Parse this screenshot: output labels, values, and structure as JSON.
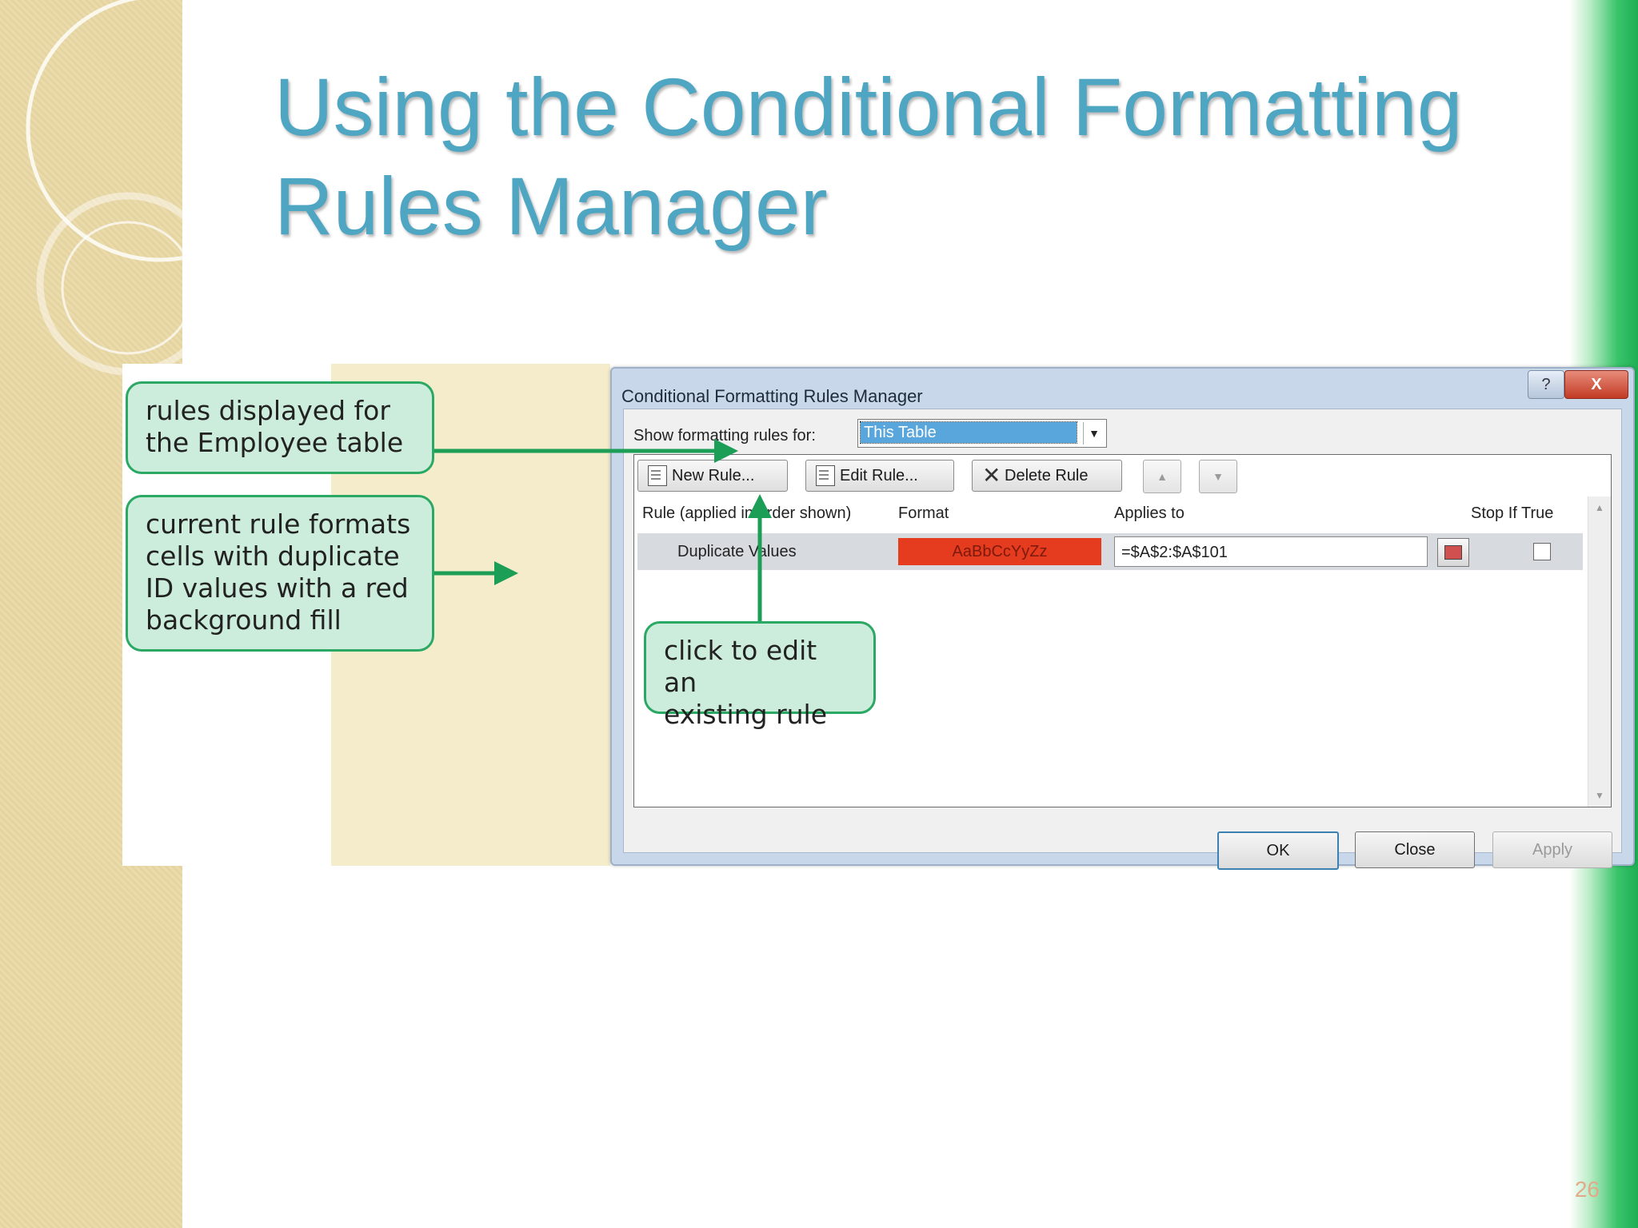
{
  "slide": {
    "title_lines": [
      "Using the Conditional Formatting",
      "Rules Manager"
    ],
    "page_number": "26"
  },
  "dialog": {
    "title": "Conditional Formatting Rules Manager",
    "help_glyph": "?",
    "close_glyph": "X",
    "show_label": "Show formatting rules for:",
    "show_value": "This Table",
    "toolbar": {
      "new_rule": "New Rule...",
      "edit_rule": "Edit Rule...",
      "delete_rule": "Delete Rule"
    },
    "columns": {
      "rule": "Rule (applied in order shown)",
      "format": "Format",
      "applies_to": "Applies to",
      "stop_if_true": "Stop If True"
    },
    "rules": [
      {
        "name": "Duplicate Values",
        "format_preview": "AaBbCcYyZz",
        "format_color": "#e53b1f",
        "applies_to": "=$A$2:$A$101",
        "stop_if_true": false
      }
    ],
    "buttons": {
      "ok": "OK",
      "close": "Close",
      "apply": "Apply"
    }
  },
  "callouts": {
    "rules_displayed": [
      "rules displayed for",
      "the Employee table"
    ],
    "current_rule": [
      "current rule formats",
      "cells with duplicate",
      "ID values with a red",
      "background fill"
    ],
    "edit_rule": [
      "click to edit an",
      "existing rule"
    ]
  },
  "colors": {
    "title": "#4fa6c2",
    "callout_fill": "#cceddc",
    "callout_border": "#2aa864",
    "arrow": "#1d9e57"
  }
}
